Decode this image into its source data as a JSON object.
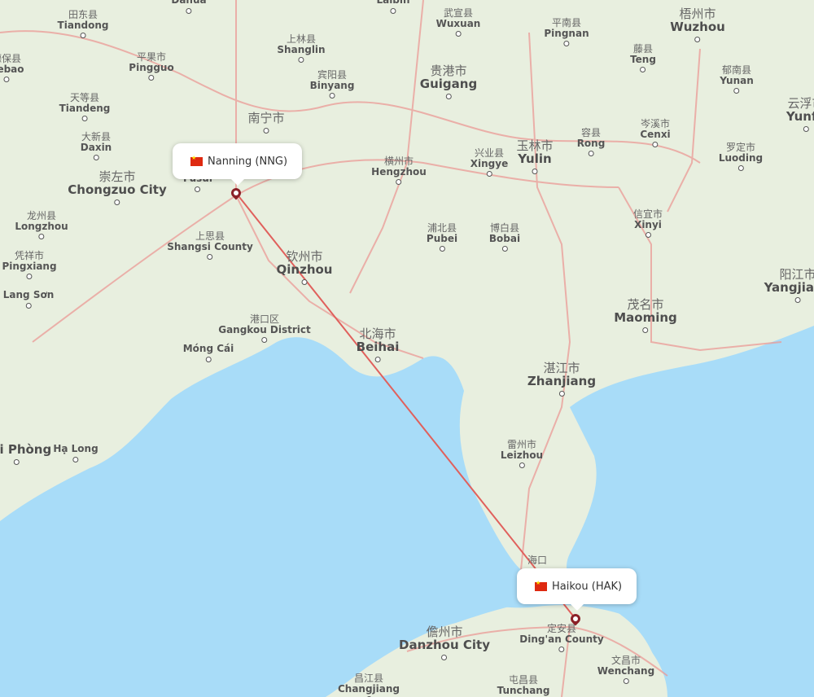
{
  "map": {
    "colors": {
      "land": "#e8efdf",
      "water": "#a8dcf8",
      "road": "#eb9a96",
      "route": "#e0605c",
      "pin": "#8b2027"
    },
    "route": {
      "from": "Nanning (NNG)",
      "to": "Haikou (HAK)"
    },
    "airports": [
      {
        "label": "Nanning (NNG)",
        "country_flag": "china-flag"
      },
      {
        "label": "Haikou (HAK)",
        "country_flag": "china-flag"
      }
    ],
    "places": [
      {
        "zh": "",
        "en": "Dahua"
      },
      {
        "zh": "",
        "en": "Laibin"
      },
      {
        "zh": "田东县",
        "en": "Tiandong"
      },
      {
        "zh": "德保县",
        "en": "Debao"
      },
      {
        "zh": "平果市",
        "en": "Pingguo"
      },
      {
        "zh": "天等县",
        "en": "Tiandeng"
      },
      {
        "zh": "大新县",
        "en": "Daxin"
      },
      {
        "zh": "上林县",
        "en": "Shanglin"
      },
      {
        "zh": "宾阳县",
        "en": "Binyang"
      },
      {
        "zh": "武宣县",
        "en": "Wuxuan"
      },
      {
        "zh": "贵港市",
        "en": "Guigang"
      },
      {
        "zh": "平南县",
        "en": "Pingnan"
      },
      {
        "zh": "梧州市",
        "en": "Wuzhou"
      },
      {
        "zh": "藤县",
        "en": "Teng"
      },
      {
        "zh": "郁南县",
        "en": "Yunan"
      },
      {
        "zh": "云浮市",
        "en": "Yunfu"
      },
      {
        "zh": "南宁市",
        "en": ""
      },
      {
        "zh": "崇左市",
        "en": "Chongzuo City"
      },
      {
        "zh": "",
        "en": "Fusui"
      },
      {
        "zh": "横州市",
        "en": "Hengzhou"
      },
      {
        "zh": "兴业县",
        "en": "Xingye"
      },
      {
        "zh": "玉林市",
        "en": "Yulin"
      },
      {
        "zh": "容县",
        "en": "Rong"
      },
      {
        "zh": "岑溪市",
        "en": "Cenxi"
      },
      {
        "zh": "罗定市",
        "en": "Luoding"
      },
      {
        "zh": "龙州县",
        "en": "Longzhou"
      },
      {
        "zh": "凭祥市",
        "en": "Pingxiang"
      },
      {
        "zh": "",
        "en": "Lang Sơn"
      },
      {
        "zh": "上思县",
        "en": "Shangsi County"
      },
      {
        "zh": "钦州市",
        "en": "Qinzhou"
      },
      {
        "zh": "浦北县",
        "en": "Pubei"
      },
      {
        "zh": "博白县",
        "en": "Bobai"
      },
      {
        "zh": "信宜市",
        "en": "Xinyi"
      },
      {
        "zh": "阳江市",
        "en": "Yangjiang"
      },
      {
        "zh": "茂名市",
        "en": "Maoming"
      },
      {
        "zh": "港口区",
        "en": "Gangkou District"
      },
      {
        "zh": "",
        "en": "Móng Cái"
      },
      {
        "zh": "北海市",
        "en": "Beihai"
      },
      {
        "zh": "湛江市",
        "en": "Zhanjiang"
      },
      {
        "zh": "雷州市",
        "en": "Leizhou"
      },
      {
        "zh": "",
        "en": "Hải Phòng"
      },
      {
        "zh": "",
        "en": "Hạ Long"
      },
      {
        "zh": "海口",
        "en": ""
      },
      {
        "zh": "儋州市",
        "en": "Danzhou City"
      },
      {
        "zh": "定安县",
        "en": "Ding'an County"
      },
      {
        "zh": "文昌市",
        "en": "Wenchang"
      },
      {
        "zh": "昌江县",
        "en": "Changjiang"
      },
      {
        "zh": "屯昌县",
        "en": "Tunchang"
      }
    ]
  }
}
